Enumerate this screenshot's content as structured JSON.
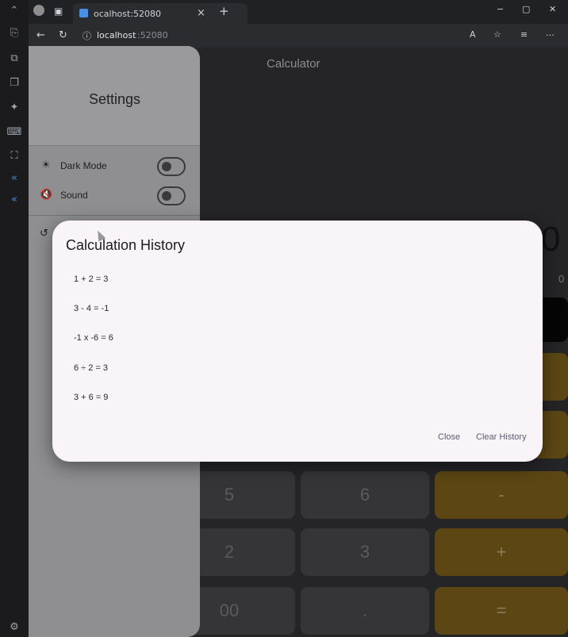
{
  "browser": {
    "tab_title": "ocalhost:52080",
    "url_host": "localhost",
    "url_port": ":52080",
    "tab_close": "×",
    "new_tab": "+",
    "window_min": "−",
    "window_max": "▢",
    "window_close": "✕"
  },
  "app": {
    "title": "Calculator",
    "display_value": "0",
    "display_sub": "0",
    "keys_row_a": [
      "5",
      "6",
      "-"
    ],
    "keys_row_b": [
      "2",
      "3",
      "+"
    ],
    "keys_row_c": [
      "00",
      ".",
      "="
    ]
  },
  "settings": {
    "title": "Settings",
    "dark_mode_label": "Dark Mode",
    "sound_label": "Sound"
  },
  "dialog": {
    "title": "Calculation History",
    "items": [
      "1 + 2 = 3",
      "3 - 4 = -1",
      "-1 x -6 = 6",
      "6 ÷ 2 = 3",
      "3 + 6 = 9"
    ],
    "close_label": "Close",
    "clear_label": "Clear History"
  }
}
